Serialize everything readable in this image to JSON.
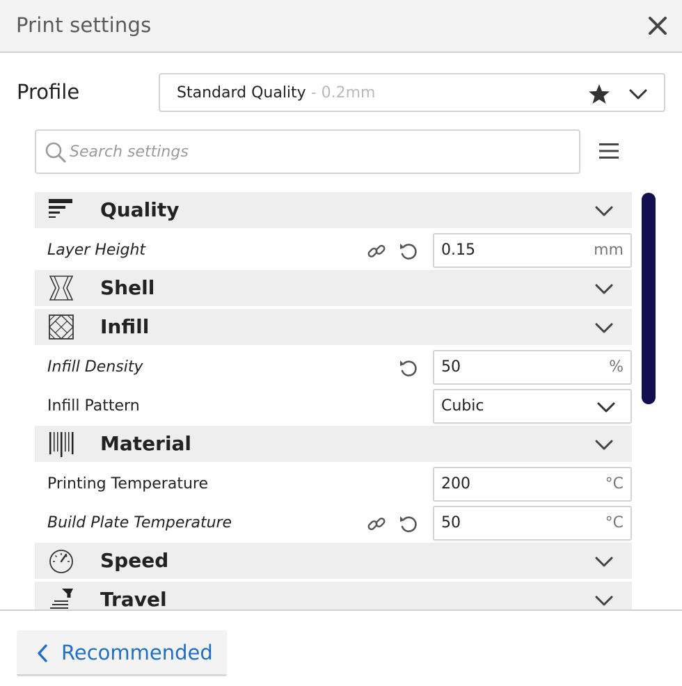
{
  "window": {
    "title": "Print settings"
  },
  "profile": {
    "label": "Profile",
    "name": "Standard Quality",
    "sub": " - 0.2mm"
  },
  "search": {
    "placeholder": "Search settings"
  },
  "categories": [
    {
      "label": "Quality",
      "icon": "quality-icon"
    },
    {
      "label": "Shell",
      "icon": "shell-icon"
    },
    {
      "label": "Infill",
      "icon": "infill-icon"
    },
    {
      "label": "Material",
      "icon": "material-icon"
    },
    {
      "label": "Speed",
      "icon": "speed-icon"
    },
    {
      "label": "Travel",
      "icon": "travel-icon"
    }
  ],
  "settings": {
    "layer_height": {
      "label": "Layer Height",
      "value": "0.15",
      "unit": "mm"
    },
    "infill_density": {
      "label": "Infill Density",
      "value": "50",
      "unit": "%"
    },
    "infill_pattern": {
      "label": "Infill Pattern",
      "value": "Cubic"
    },
    "printing_temperature": {
      "label": "Printing Temperature",
      "value": "200",
      "unit": "°C"
    },
    "build_plate_temperature": {
      "label": "Build Plate Temperature",
      "value": "50",
      "unit": "°C"
    }
  },
  "footer": {
    "recommended_label": "Recommended"
  },
  "colors": {
    "scrollbar": "#12104e",
    "link_blue": "#1f6fc4",
    "category_bg": "#eeeeee"
  }
}
